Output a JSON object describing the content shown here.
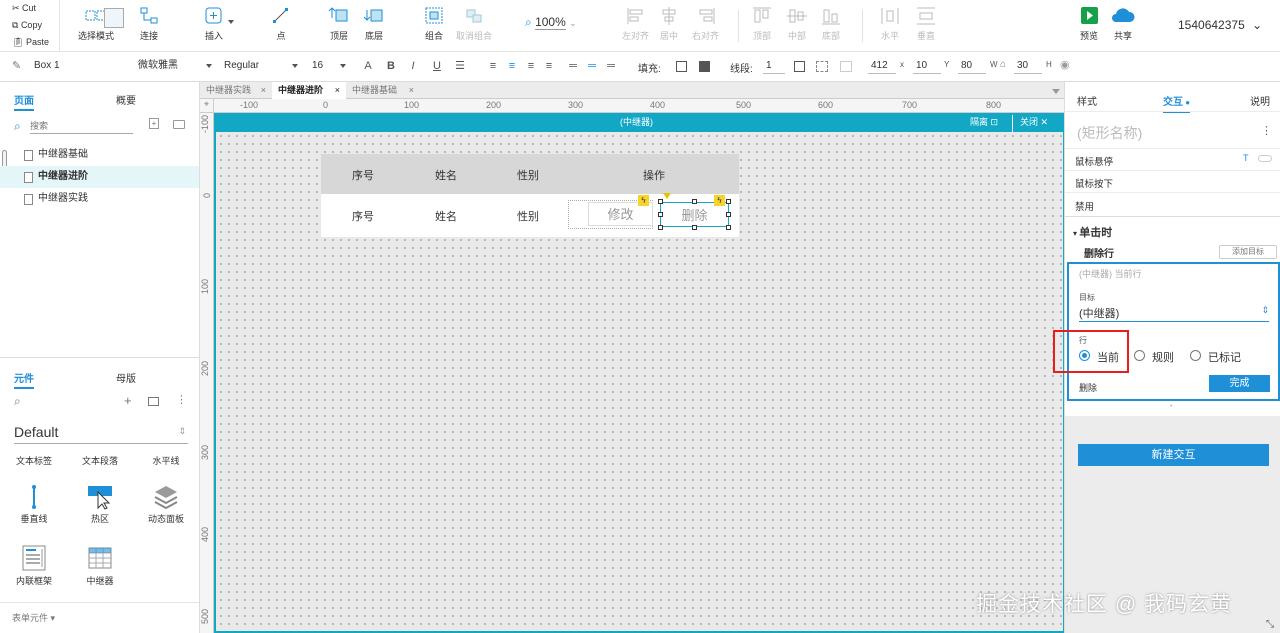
{
  "clipboard": {
    "cut": "Cut",
    "copy": "Copy",
    "paste": "Paste"
  },
  "toolbar": {
    "select_mode": "选择模式",
    "connect": "连接",
    "insert": "插入",
    "point": "点",
    "top_layer": "顶层",
    "bottom_layer": "底层",
    "group": "组合",
    "ungroup": "取消组合",
    "zoom": "100%",
    "align_left": "左对齐",
    "align_center": "居中",
    "align_right": "右对齐",
    "align_top": "顶部",
    "align_middle": "中部",
    "align_bottom": "底部",
    "distribute_h": "水平",
    "distribute_v": "垂直",
    "preview": "预览",
    "share": "共享",
    "user_id": "1540642375"
  },
  "format": {
    "widget_name": "Box 1",
    "font_family": "微软雅黑",
    "font_style": "Regular",
    "font_size": "16",
    "fill_label": "填充:",
    "border_label": "线段:",
    "border_width": "1",
    "x": "412",
    "x_label": "x",
    "y": "10",
    "y_label": "Y",
    "w": "80",
    "w_label": "W",
    "h": "30",
    "h_label": "H"
  },
  "left_panel": {
    "tab_pages": "页面",
    "tab_outline": "概要",
    "search_placeholder": "搜索",
    "pages": [
      "中继器基础",
      "中继器进阶",
      "中继器实践"
    ],
    "tab_widgets": "元件",
    "tab_masters": "母版",
    "library": "Default",
    "widgets_row0": [
      "文本标签",
      "文本段落",
      "水平线"
    ],
    "widgets_row1": [
      "垂直线",
      "热区",
      "动态面板"
    ],
    "widgets_row2": [
      "内联框架",
      "中继器"
    ],
    "form_widgets": "表单元件"
  },
  "doc_tabs": [
    "中继器实践",
    "中继器进阶",
    "中继器基础"
  ],
  "ruler_top": [
    "-100",
    "0",
    "100",
    "200",
    "300",
    "400",
    "500",
    "600",
    "700",
    "800"
  ],
  "ruler_left": [
    "-100",
    "0",
    "100",
    "200",
    "300",
    "400",
    "500"
  ],
  "repeater_bar": {
    "title": "(中继器)",
    "isolate": "隔离",
    "close": "关闭"
  },
  "table": {
    "headers": [
      "序号",
      "姓名",
      "性别",
      "操作"
    ],
    "row": [
      "序号",
      "姓名",
      "性别"
    ],
    "edit_btn": "修改",
    "delete_btn": "删除"
  },
  "right_panel": {
    "tab_style": "样式",
    "tab_interaction": "交互",
    "tab_notes": "说明",
    "shape_name_placeholder": "(矩形名称)",
    "events": [
      "鼠标悬停",
      "鼠标按下",
      "禁用"
    ],
    "on_click": "单击时",
    "action": "删除行",
    "add_target": "添加目标",
    "target_summary": "(中继器) 当前行",
    "target_label": "目标",
    "target_value": "(中继器)",
    "row_label": "行",
    "row_options": [
      "当前",
      "规则",
      "已标记"
    ],
    "selected_row_option": "当前",
    "delete": "删除",
    "done": "完成",
    "new_interaction": "新建交互"
  },
  "watermark": "掘金技术社区 @ 我码玄黄",
  "colors": {
    "accent": "#12a7c5",
    "primary_blue": "#1f8fd8",
    "highlight_red": "#e81e1e",
    "header_gray": "#d7d7d7"
  }
}
